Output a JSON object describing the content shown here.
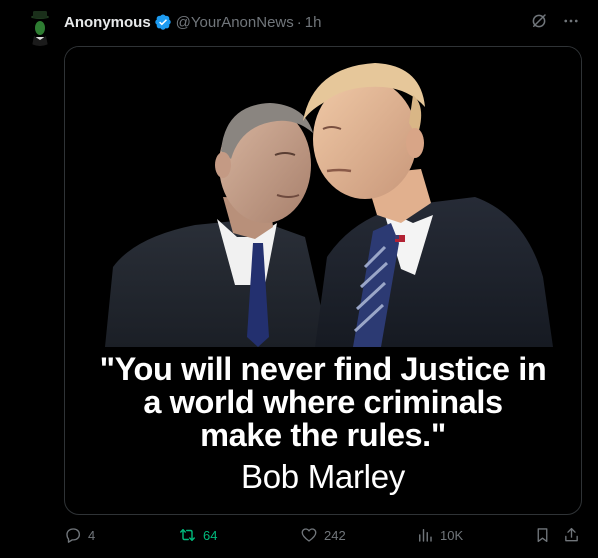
{
  "post": {
    "author": {
      "display_name": "Anonymous",
      "handle": "@YourAnonNews",
      "separator": "·",
      "time": "1h",
      "verified": true
    },
    "image_text": {
      "quote_lines": [
        "\"You will never find Justice in",
        "a world where criminals",
        "make the rules.\""
      ],
      "attribution": "Bob Marley"
    },
    "stats": {
      "replies": "4",
      "reposts": "64",
      "likes": "242",
      "views": "10K"
    }
  },
  "icons": {
    "verified": "verified-badge-icon",
    "grok": "grok-icon",
    "more": "more-icon",
    "reply": "reply-icon",
    "repost": "repost-icon",
    "like": "heart-icon",
    "views": "views-icon",
    "bookmark": "bookmark-icon",
    "share": "share-icon"
  },
  "colors": {
    "background": "#000000",
    "text_primary": "#e7e9ea",
    "text_secondary": "#71767b",
    "verified_blue": "#1d9bf0",
    "repost_green": "#00ba7c",
    "border": "#2f3336"
  }
}
